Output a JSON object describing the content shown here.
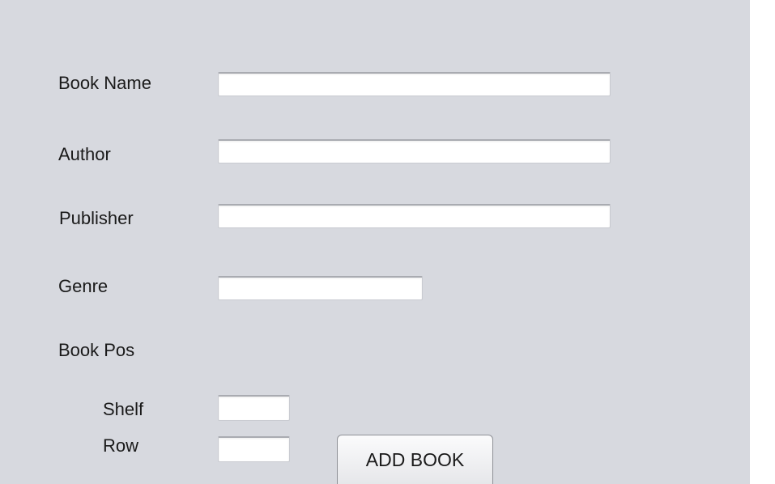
{
  "form": {
    "book_name_label": "Book Name",
    "book_name_value": "",
    "author_label": "Author",
    "author_value": "",
    "publisher_label": "Publisher",
    "publisher_value": "",
    "genre_label": "Genre",
    "genre_value": "",
    "book_pos_label": "Book Pos",
    "shelf_label": "Shelf",
    "shelf_value": "",
    "row_label": "Row",
    "row_value": "",
    "add_button_label": "ADD BOOK"
  },
  "colors": {
    "panel_background": "#d7d9df",
    "field_background": "#ffffff"
  }
}
